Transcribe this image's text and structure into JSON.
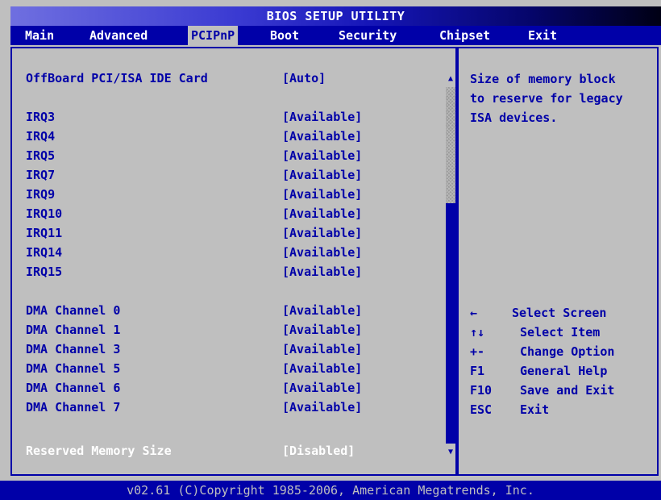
{
  "title": "BIOS SETUP UTILITY",
  "menu": [
    {
      "label": "Main"
    },
    {
      "label": "Advanced"
    },
    {
      "label": "PCIPnP"
    },
    {
      "label": "Boot"
    },
    {
      "label": "Security"
    },
    {
      "label": "Chipset"
    },
    {
      "label": "Exit"
    }
  ],
  "active_menu": "PCIPnP",
  "settings": [
    {
      "label": "OffBoard PCI/ISA IDE Card",
      "value": "[Auto]"
    },
    {
      "label": "IRQ3",
      "value": "[Available]"
    },
    {
      "label": "IRQ4",
      "value": "[Available]"
    },
    {
      "label": "IRQ5",
      "value": "[Available]"
    },
    {
      "label": "IRQ7",
      "value": "[Available]"
    },
    {
      "label": "IRQ9",
      "value": "[Available]"
    },
    {
      "label": "IRQ10",
      "value": "[Available]"
    },
    {
      "label": "IRQ11",
      "value": "[Available]"
    },
    {
      "label": "IRQ14",
      "value": "[Available]"
    },
    {
      "label": "IRQ15",
      "value": "[Available]"
    },
    {
      "label": "DMA Channel 0",
      "value": "[Available]"
    },
    {
      "label": "DMA Channel 1",
      "value": "[Available]"
    },
    {
      "label": "DMA Channel 3",
      "value": "[Available]"
    },
    {
      "label": "DMA Channel 5",
      "value": "[Available]"
    },
    {
      "label": "DMA Channel 6",
      "value": "[Available]"
    },
    {
      "label": "DMA Channel 7",
      "value": "[Available]"
    },
    {
      "label": "Reserved Memory Size",
      "value": "[Disabled]"
    }
  ],
  "selected_setting": "Reserved Memory Size",
  "help": {
    "lines": [
      "Size of memory block",
      "to reserve for legacy",
      "ISA devices."
    ]
  },
  "keys": [
    {
      "key": "←",
      "desc": "Select Screen"
    },
    {
      "key": "↑↓",
      "desc": "Select Item"
    },
    {
      "key": "+-",
      "desc": "Change Option"
    },
    {
      "key": "F1",
      "desc": "General Help"
    },
    {
      "key": "F10",
      "desc": "Save and Exit"
    },
    {
      "key": "ESC",
      "desc": "Exit"
    }
  ],
  "scrollbar": {
    "up_icon": "triangle-up",
    "down_icon": "triangle-down"
  },
  "footer": "v02.61 (C)Copyright 1985-2006, American Megatrends, Inc.",
  "colors": {
    "background": "#bfbfbf",
    "accent": "#0000a8",
    "selected_text": "#ffffff"
  }
}
